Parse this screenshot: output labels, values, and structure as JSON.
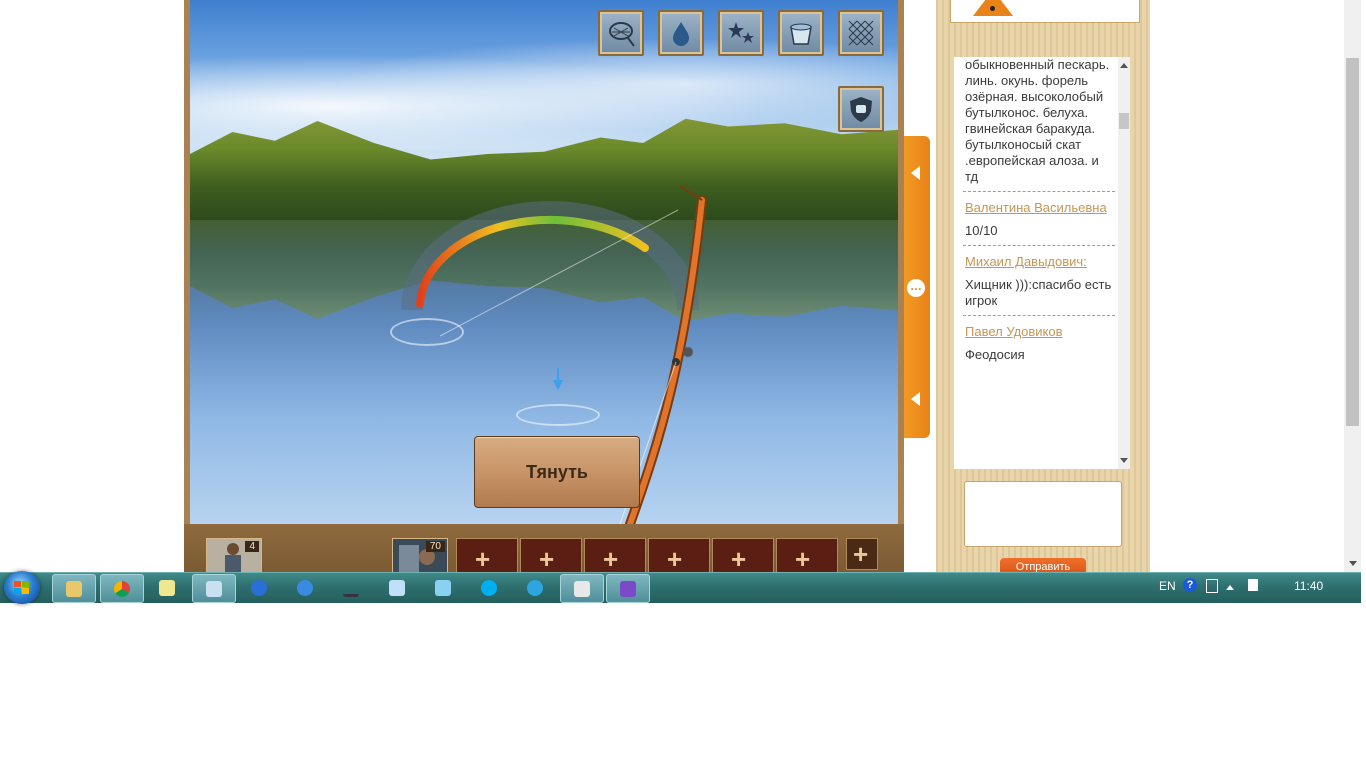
{
  "game": {
    "pull_button_label": "Тянуть",
    "tools": [
      {
        "name": "landing-net-icon"
      },
      {
        "name": "water-drop-icon"
      },
      {
        "name": "stars-icon"
      },
      {
        "name": "bucket-icon"
      },
      {
        "name": "fishing-net-icon"
      },
      {
        "name": "shield-fist-icon"
      }
    ],
    "tension_gauge_colors": [
      "#e0401a",
      "#f0c020",
      "#6cc03a",
      "#f0c020"
    ],
    "bottom_bar": {
      "player_count": "4",
      "bait_count": "70",
      "empty_slot_symbol": "+"
    }
  },
  "chat": {
    "messages": [
      {
        "author": "",
        "text": "обыкновенный пескарь. линь. окунь. форель озёрная. высоколобый бутылконос. белуха. гвинейская баракуда. бутылконосый скат .европейская алоза. и тд"
      },
      {
        "author": "Валентина Васильевна",
        "text": "10/10"
      },
      {
        "author": "Михаил Давыдович:",
        "text": "Хищник ))):спасибо есть игрок"
      },
      {
        "author": "Павел Удовиков",
        "text": "Феодосия"
      }
    ],
    "send_label": "Отправить"
  },
  "taskbar": {
    "language": "EN",
    "help": "?",
    "clock": "11:40"
  },
  "colors": {
    "accent_orange": "#e8831a",
    "wood": "#a98152",
    "link": "#c49655"
  }
}
